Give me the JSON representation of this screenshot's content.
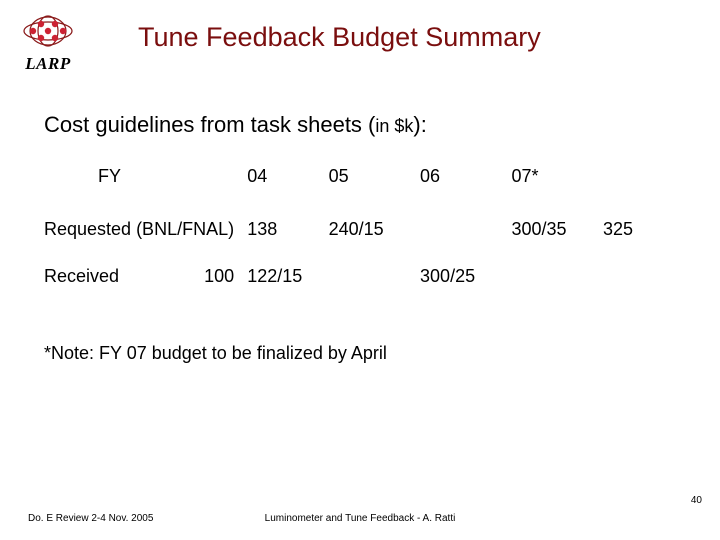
{
  "header": {
    "logo_label": "LARP",
    "title": "Tune Feedback Budget Summary"
  },
  "subtitle": {
    "main": "Cost guidelines from task sheets (",
    "small": "in $k",
    "tail": "):"
  },
  "table": {
    "fy_label": "FY",
    "headers": [
      "04",
      "05",
      "06",
      "07*"
    ],
    "rows": [
      {
        "label": "Requested (BNL/FNAL)",
        "c04": "138",
        "c05": "240/15",
        "c06": "300/35",
        "c07": "325"
      },
      {
        "label": "Received",
        "extra": "100",
        "c04": "122/15",
        "c05": "300/25",
        "c06": "",
        "c07": ""
      }
    ]
  },
  "note": "*Note: FY 07 budget to be finalized by April",
  "footer": {
    "left": "Do. E Review 2-4 Nov. 2005",
    "center": "Luminometer and Tune Feedback - A. Ratti",
    "page": "40"
  },
  "chart_data": {
    "type": "table",
    "title": "Tune Feedback Budget Summary — Cost guidelines from task sheets (in $k)",
    "columns": [
      "FY",
      "04",
      "05",
      "06",
      "07*"
    ],
    "rows": [
      [
        "Requested (BNL/FNAL)",
        "138",
        "240/15",
        "300/35",
        "325"
      ],
      [
        "Received (100)",
        "122/15",
        "300/25",
        "",
        ""
      ]
    ],
    "note": "*FY 07 budget to be finalized by April"
  }
}
